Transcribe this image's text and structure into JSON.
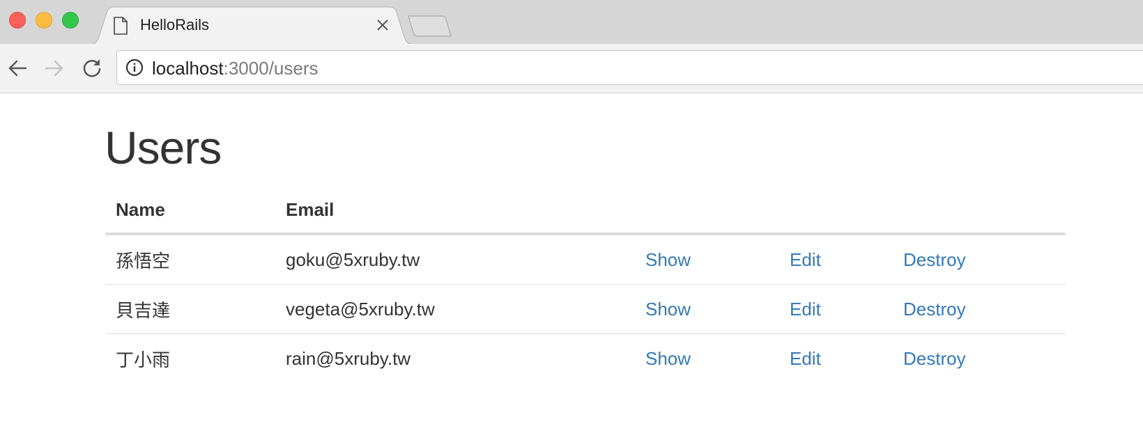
{
  "browser": {
    "tab_title": "HelloRails",
    "url_host": "localhost",
    "url_rest": ":3000/users",
    "colors": {
      "close": "#fc605b",
      "minimize": "#fdbc40",
      "maximize": "#34c84a"
    }
  },
  "page": {
    "title": "Users",
    "link_color": "#337ab7",
    "table": {
      "headers": [
        "Name",
        "Email",
        "",
        "",
        ""
      ],
      "rows": [
        {
          "name": "孫悟空",
          "email": "goku@5xruby.tw",
          "show": "Show",
          "edit": "Edit",
          "destroy": "Destroy"
        },
        {
          "name": "貝吉達",
          "email": "vegeta@5xruby.tw",
          "show": "Show",
          "edit": "Edit",
          "destroy": "Destroy"
        },
        {
          "name": "丁小雨",
          "email": "rain@5xruby.tw",
          "show": "Show",
          "edit": "Edit",
          "destroy": "Destroy"
        }
      ]
    }
  },
  "icons": {
    "tab": "document-icon",
    "tab_close": "close-icon",
    "back": "arrow-left-icon",
    "forward": "arrow-right-icon",
    "reload": "reload-icon",
    "site_info": "info-icon"
  }
}
